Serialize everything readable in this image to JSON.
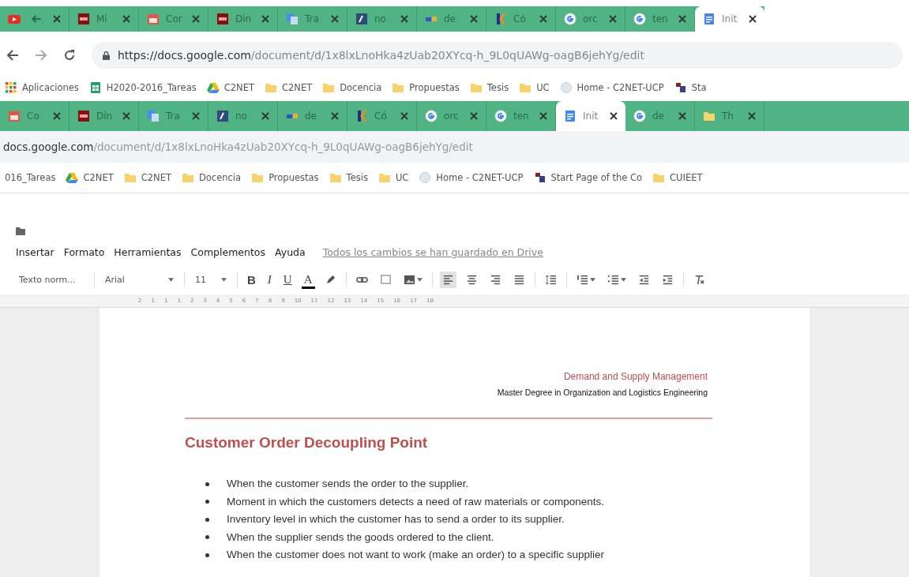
{
  "front_window": {
    "tabs": [
      {
        "kind": "video",
        "selected": false
      },
      {
        "kind": "upv",
        "title": "Mi",
        "selected": false
      },
      {
        "kind": "calendar",
        "title": "Cor",
        "selected": false
      },
      {
        "kind": "upv",
        "title": "Din",
        "selected": false
      },
      {
        "kind": "translate",
        "title": "Tra",
        "selected": false
      },
      {
        "kind": "dictionary",
        "title": "no",
        "selected": false
      },
      {
        "kind": "wordref",
        "title": "de",
        "selected": false
      },
      {
        "kind": "k",
        "title": "Có",
        "selected": false
      },
      {
        "kind": "google",
        "title": "orc",
        "selected": false
      },
      {
        "kind": "google",
        "title": "ten",
        "selected": false
      },
      {
        "kind": "docs",
        "title": "Init",
        "selected": true
      }
    ],
    "url_host": "https://docs.google.com",
    "url_path": "/document/d/1x8lxLnoHka4zUab20XYcq-h_9L0qUAWg-oagB6jehYg/edit",
    "bookmarks": [
      {
        "kind": "apps",
        "label": "Aplicaciones"
      },
      {
        "kind": "sheet",
        "label": "H2020-2016_Tareas"
      },
      {
        "kind": "drive",
        "label": "C2NET"
      },
      {
        "kind": "folder",
        "label": "C2NET"
      },
      {
        "kind": "folder",
        "label": "Docencia"
      },
      {
        "kind": "folder",
        "label": "Propuestas"
      },
      {
        "kind": "folder",
        "label": "Tesis"
      },
      {
        "kind": "folder",
        "label": "UC"
      },
      {
        "kind": "globe",
        "label": "Home - C2NET-UCP"
      },
      {
        "kind": "puzzle",
        "label": "Sta"
      }
    ]
  },
  "back_window": {
    "tabs": [
      {
        "kind": "calendar",
        "title": "Co",
        "selected": false
      },
      {
        "kind": "upv",
        "title": "Din",
        "selected": false
      },
      {
        "kind": "translate",
        "title": "Tra",
        "selected": false
      },
      {
        "kind": "dictionary",
        "title": "no",
        "selected": false
      },
      {
        "kind": "wordref",
        "title": "de",
        "selected": false
      },
      {
        "kind": "k",
        "title": "Có",
        "selected": false
      },
      {
        "kind": "google",
        "title": "orc",
        "selected": false
      },
      {
        "kind": "google",
        "title": "ten",
        "selected": false
      },
      {
        "kind": "docs",
        "title": "Init",
        "selected": true
      },
      {
        "kind": "google",
        "title": "de",
        "selected": false
      },
      {
        "kind": "folder",
        "title": "Th",
        "selected": false
      }
    ],
    "url_host": "docs.google.com",
    "url_path": "/document/d/1x8lxLnoHka4zUab20XYcq-h_9L0qUAWg-oagB6jehYg/edit",
    "bookmarks": [
      {
        "kind": "none",
        "label": "016_Tareas"
      },
      {
        "kind": "drive",
        "label": "C2NET"
      },
      {
        "kind": "folder",
        "label": "C2NET"
      },
      {
        "kind": "folder",
        "label": "Docencia"
      },
      {
        "kind": "folder",
        "label": "Propuestas"
      },
      {
        "kind": "folder",
        "label": "Tesis"
      },
      {
        "kind": "folder",
        "label": "UC"
      },
      {
        "kind": "globe",
        "label": "Home - C2NET-UCP"
      },
      {
        "kind": "puzzle",
        "label": "Start Page of the Co"
      },
      {
        "kind": "folder",
        "label": "CUIEET"
      }
    ]
  },
  "docs": {
    "menu": [
      "Insertar",
      "Formato",
      "Herramientas",
      "Complementos",
      "Ayuda"
    ],
    "save_status": "Todos los cambios se han guardado en Drive",
    "toolbar": [
      {
        "kind": "dropdown",
        "label": "Texto norm..."
      },
      {
        "kind": "separator"
      },
      {
        "kind": "dropdown",
        "label": "Arial"
      },
      {
        "kind": "separator"
      },
      {
        "kind": "dropdown",
        "label": "11"
      },
      {
        "kind": "separator"
      },
      {
        "kind": "bold",
        "label": "B"
      },
      {
        "kind": "italic",
        "label": "I"
      },
      {
        "kind": "underline",
        "label": "U"
      },
      {
        "kind": "color",
        "label": "A"
      },
      {
        "kind": "highlight"
      },
      {
        "kind": "separator"
      },
      {
        "kind": "link"
      },
      {
        "kind": "comment"
      },
      {
        "kind": "image",
        "menu": true
      },
      {
        "kind": "separator"
      },
      {
        "kind": "align-left",
        "selected": true
      },
      {
        "kind": "align-center",
        "selected": false
      },
      {
        "kind": "align-right",
        "selected": false
      },
      {
        "kind": "justify",
        "selected": false
      },
      {
        "kind": "separator"
      },
      {
        "kind": "line-spacing"
      },
      {
        "kind": "separator"
      },
      {
        "kind": "numbered-list",
        "menu": true
      },
      {
        "kind": "bulleted-list",
        "menu": true
      },
      {
        "kind": "outdent"
      },
      {
        "kind": "indent"
      },
      {
        "kind": "separator"
      },
      {
        "kind": "clear-format"
      }
    ],
    "ruler": [
      "2",
      "1",
      "1",
      "1",
      "2",
      "3",
      "4",
      "5",
      "6",
      "7",
      "8",
      "9",
      "10",
      "11",
      "12",
      "13",
      "14",
      "15",
      "16",
      "17",
      "18"
    ],
    "page": {
      "header_title": "Demand and Supply Management",
      "header_subtitle": "Master Degree in Organization and Logistics Engineering",
      "heading": "Customer Order Decoupling Point",
      "bullets": [
        "When the customer sends the order to the supplier.",
        "Moment in which the customers detects a need of raw materials or components.",
        "Inventory level in which the customer has to send a order to its supplier.",
        "When the supplier sends the goods ordered to the client.",
        "When the customer does not want to work (make an order) to a specific supplier"
      ]
    }
  }
}
